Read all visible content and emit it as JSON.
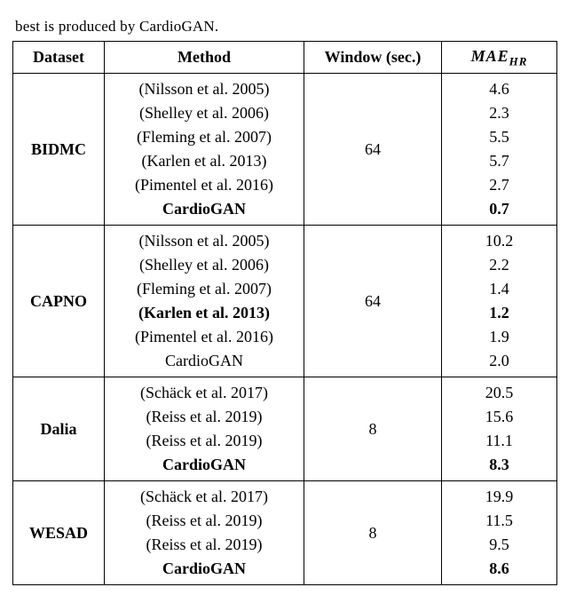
{
  "caption_stub": "best is produced by CardioGAN.",
  "headers": {
    "dataset": "Dataset",
    "method": "Method",
    "window": "Window (sec.)",
    "mae_main": "MAE",
    "mae_sub": "HR"
  },
  "chart_data": {
    "type": "table",
    "title": "MAE_HR by dataset and method",
    "groups": [
      {
        "dataset": "BIDMC",
        "window": "64",
        "rows": [
          {
            "method": "(Nilsson et al. 2005)",
            "mae": "4.6",
            "method_bold": false,
            "mae_bold": false
          },
          {
            "method": "(Shelley et al. 2006)",
            "mae": "2.3",
            "method_bold": false,
            "mae_bold": false
          },
          {
            "method": "(Fleming et al. 2007)",
            "mae": "5.5",
            "method_bold": false,
            "mae_bold": false
          },
          {
            "method": "(Karlen et al. 2013)",
            "mae": "5.7",
            "method_bold": false,
            "mae_bold": false
          },
          {
            "method": "(Pimentel et al. 2016)",
            "mae": "2.7",
            "method_bold": false,
            "mae_bold": false
          },
          {
            "method": "CardioGAN",
            "mae": "0.7",
            "method_bold": true,
            "mae_bold": true
          }
        ]
      },
      {
        "dataset": "CAPNO",
        "window": "64",
        "rows": [
          {
            "method": "(Nilsson et al. 2005)",
            "mae": "10.2",
            "method_bold": false,
            "mae_bold": false
          },
          {
            "method": "(Shelley et al. 2006)",
            "mae": "2.2",
            "method_bold": false,
            "mae_bold": false
          },
          {
            "method": "(Fleming et al. 2007)",
            "mae": "1.4",
            "method_bold": false,
            "mae_bold": false
          },
          {
            "method": "(Karlen et al. 2013)",
            "mae": "1.2",
            "method_bold": true,
            "mae_bold": true
          },
          {
            "method": "(Pimentel et al. 2016)",
            "mae": "1.9",
            "method_bold": false,
            "mae_bold": false
          },
          {
            "method": "CardioGAN",
            "mae": "2.0",
            "method_bold": false,
            "mae_bold": false
          }
        ]
      },
      {
        "dataset": "Dalia",
        "window": "8",
        "rows": [
          {
            "method": "(Schäck et al. 2017)",
            "mae": "20.5",
            "method_bold": false,
            "mae_bold": false
          },
          {
            "method": "(Reiss et al. 2019)",
            "mae": "15.6",
            "method_bold": false,
            "mae_bold": false
          },
          {
            "method": "(Reiss et al. 2019)",
            "mae": "11.1",
            "method_bold": false,
            "mae_bold": false
          },
          {
            "method": "CardioGAN",
            "mae": "8.3",
            "method_bold": true,
            "mae_bold": true
          }
        ]
      },
      {
        "dataset": "WESAD",
        "window": "8",
        "rows": [
          {
            "method": "(Schäck et al. 2017)",
            "mae": "19.9",
            "method_bold": false,
            "mae_bold": false
          },
          {
            "method": "(Reiss et al. 2019)",
            "mae": "11.5",
            "method_bold": false,
            "mae_bold": false
          },
          {
            "method": "(Reiss et al. 2019)",
            "mae": "9.5",
            "method_bold": false,
            "mae_bold": false
          },
          {
            "method": "CardioGAN",
            "mae": "8.6",
            "method_bold": true,
            "mae_bold": true
          }
        ]
      }
    ]
  }
}
